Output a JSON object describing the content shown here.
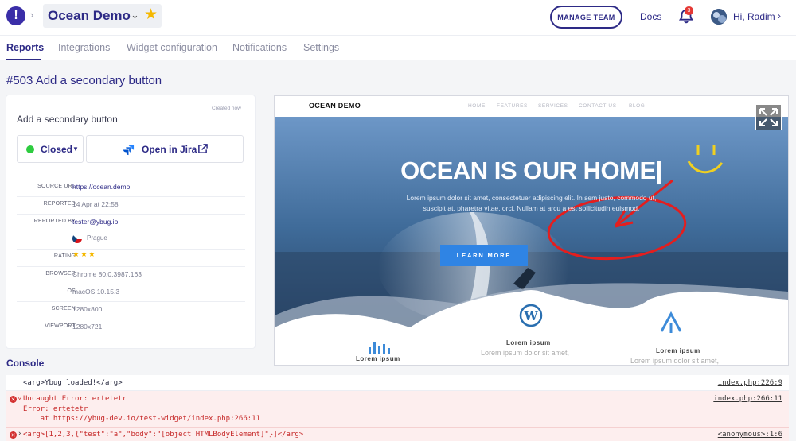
{
  "header": {
    "logo_glyph": "!",
    "project_name": "Ocean Demo",
    "manage_team_label": "MANAGE TEAM",
    "docs_label": "Docs",
    "notification_count": "3",
    "greeting": "Hi, Radim",
    "icons": {
      "logo": "ybug-logo-icon",
      "bell": "bell-icon",
      "star": "star-icon",
      "avatar": "user-avatar"
    }
  },
  "tabs": [
    {
      "label": "Reports",
      "active": true
    },
    {
      "label": "Integrations",
      "active": false
    },
    {
      "label": "Widget configuration",
      "active": false
    },
    {
      "label": "Notifications",
      "active": false
    },
    {
      "label": "Settings",
      "active": false
    }
  ],
  "report": {
    "title": "#503 Add a secondary button",
    "created": "Created now",
    "name": "Add a secondary button",
    "status": "Closed",
    "jira_label": "Open in Jira",
    "details": {
      "source_url_key": "SOURCE URL",
      "source_url": "https://ocean.demo",
      "reported_key": "REPORTED",
      "reported": "14 Apr at 22:58",
      "reported_by_key": "REPORTED BY",
      "reported_by": "tester@ybug.io",
      "location": "Prague",
      "rating_key": "RATING",
      "rating": 3,
      "rating_max": 3,
      "browser_key": "BROWSER",
      "browser": "Chrome 80.0.3987.163",
      "os_key": "OS",
      "os": "macOS 10.15.3",
      "screen_key": "SCREEN",
      "screen": "1280x800",
      "viewport_key": "VIEWPORT",
      "viewport": "1280x721"
    },
    "colors": {
      "accent": "#2d2a86",
      "status_closed": "#2ecc40",
      "star": "#f5b800"
    }
  },
  "screenshot": {
    "site_logo": "OCEAN DEMO",
    "nav": [
      "HOME",
      "FEATURES",
      "SERVICES",
      "CONTACT US",
      "BLOG"
    ],
    "hero_title": "OCEAN IS OUR HOME|",
    "hero_text": "Lorem ipsum dolor sit amet, consectetuer adipiscing elit. In sem justo, commodo ut, suscipit at, pharetra vitae, orci. Nullam at arcu a est sollicitudin euismod.",
    "cta_label": "LEARN MORE",
    "features": [
      {
        "title": "Lorem ipsum",
        "text": ""
      },
      {
        "title": "Lorem ipsum",
        "text": "Lorem ipsum dolor sit amet,"
      },
      {
        "title": "Lorem ipsum",
        "text": "Lorem ipsum dolor sit amet,"
      }
    ]
  },
  "console": {
    "title": "Console",
    "lines": [
      {
        "type": "log",
        "text": "<arg>Ybug loaded!</arg>",
        "location": "index.php:226:9"
      },
      {
        "type": "error",
        "text": "Uncaught Error: ertetetr\nError: ertetetr\n    at https://ybug-dev.io/test-widget/index.php:266:11",
        "location": "index.php:266:11"
      },
      {
        "type": "error",
        "text": "<arg>[1,2,3,{\"test\":\"a\",\"body\":\"[object HTMLBodyElement]\"}]</arg>",
        "location": "<anonymous>:1:6"
      }
    ]
  }
}
